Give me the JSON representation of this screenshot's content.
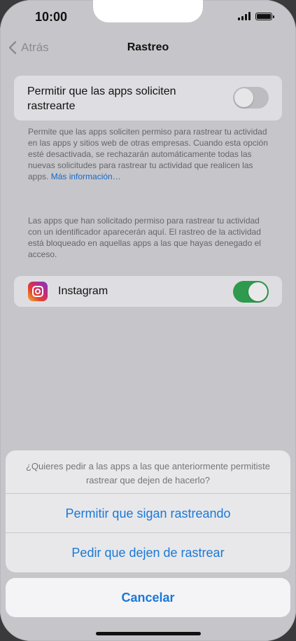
{
  "status_bar": {
    "time": "10:00"
  },
  "nav": {
    "back_label": "Atrás",
    "title": "Rastreo"
  },
  "allow_tracking": {
    "label": "Permitir que las apps soliciten rastrearte",
    "enabled": false,
    "footnote_text": "Permite que las apps soliciten permiso para rastrear tu actividad en las apps y sitios web de otras empresas. Cuando esta opción esté desactivada, se rechazarán automáticamente todas las nuevas solicitudes para rastrear tu actividad que realicen las apps.",
    "footnote_link": "Más información…"
  },
  "apps_footnote": "Las apps que han solicitado permiso para rastrear tu actividad con un identificador aparecerán aquí. El rastreo de la actividad está bloqueado en aquellas apps a las que hayas denegado el acceso.",
  "apps": [
    {
      "name": "Instagram",
      "enabled": true,
      "icon": "instagram-icon"
    }
  ],
  "action_sheet": {
    "message": "¿Quieres pedir a las apps a las que anteriormente permitiste rastrear que dejen de hacerlo?",
    "option_allow": "Permitir que sigan rastreando",
    "option_ask": "Pedir que dejen de rastrear",
    "cancel": "Cancelar"
  },
  "colors": {
    "accent": "#1a78d8",
    "toggle_on": "#2f9a4e",
    "link": "#1a67c6"
  }
}
